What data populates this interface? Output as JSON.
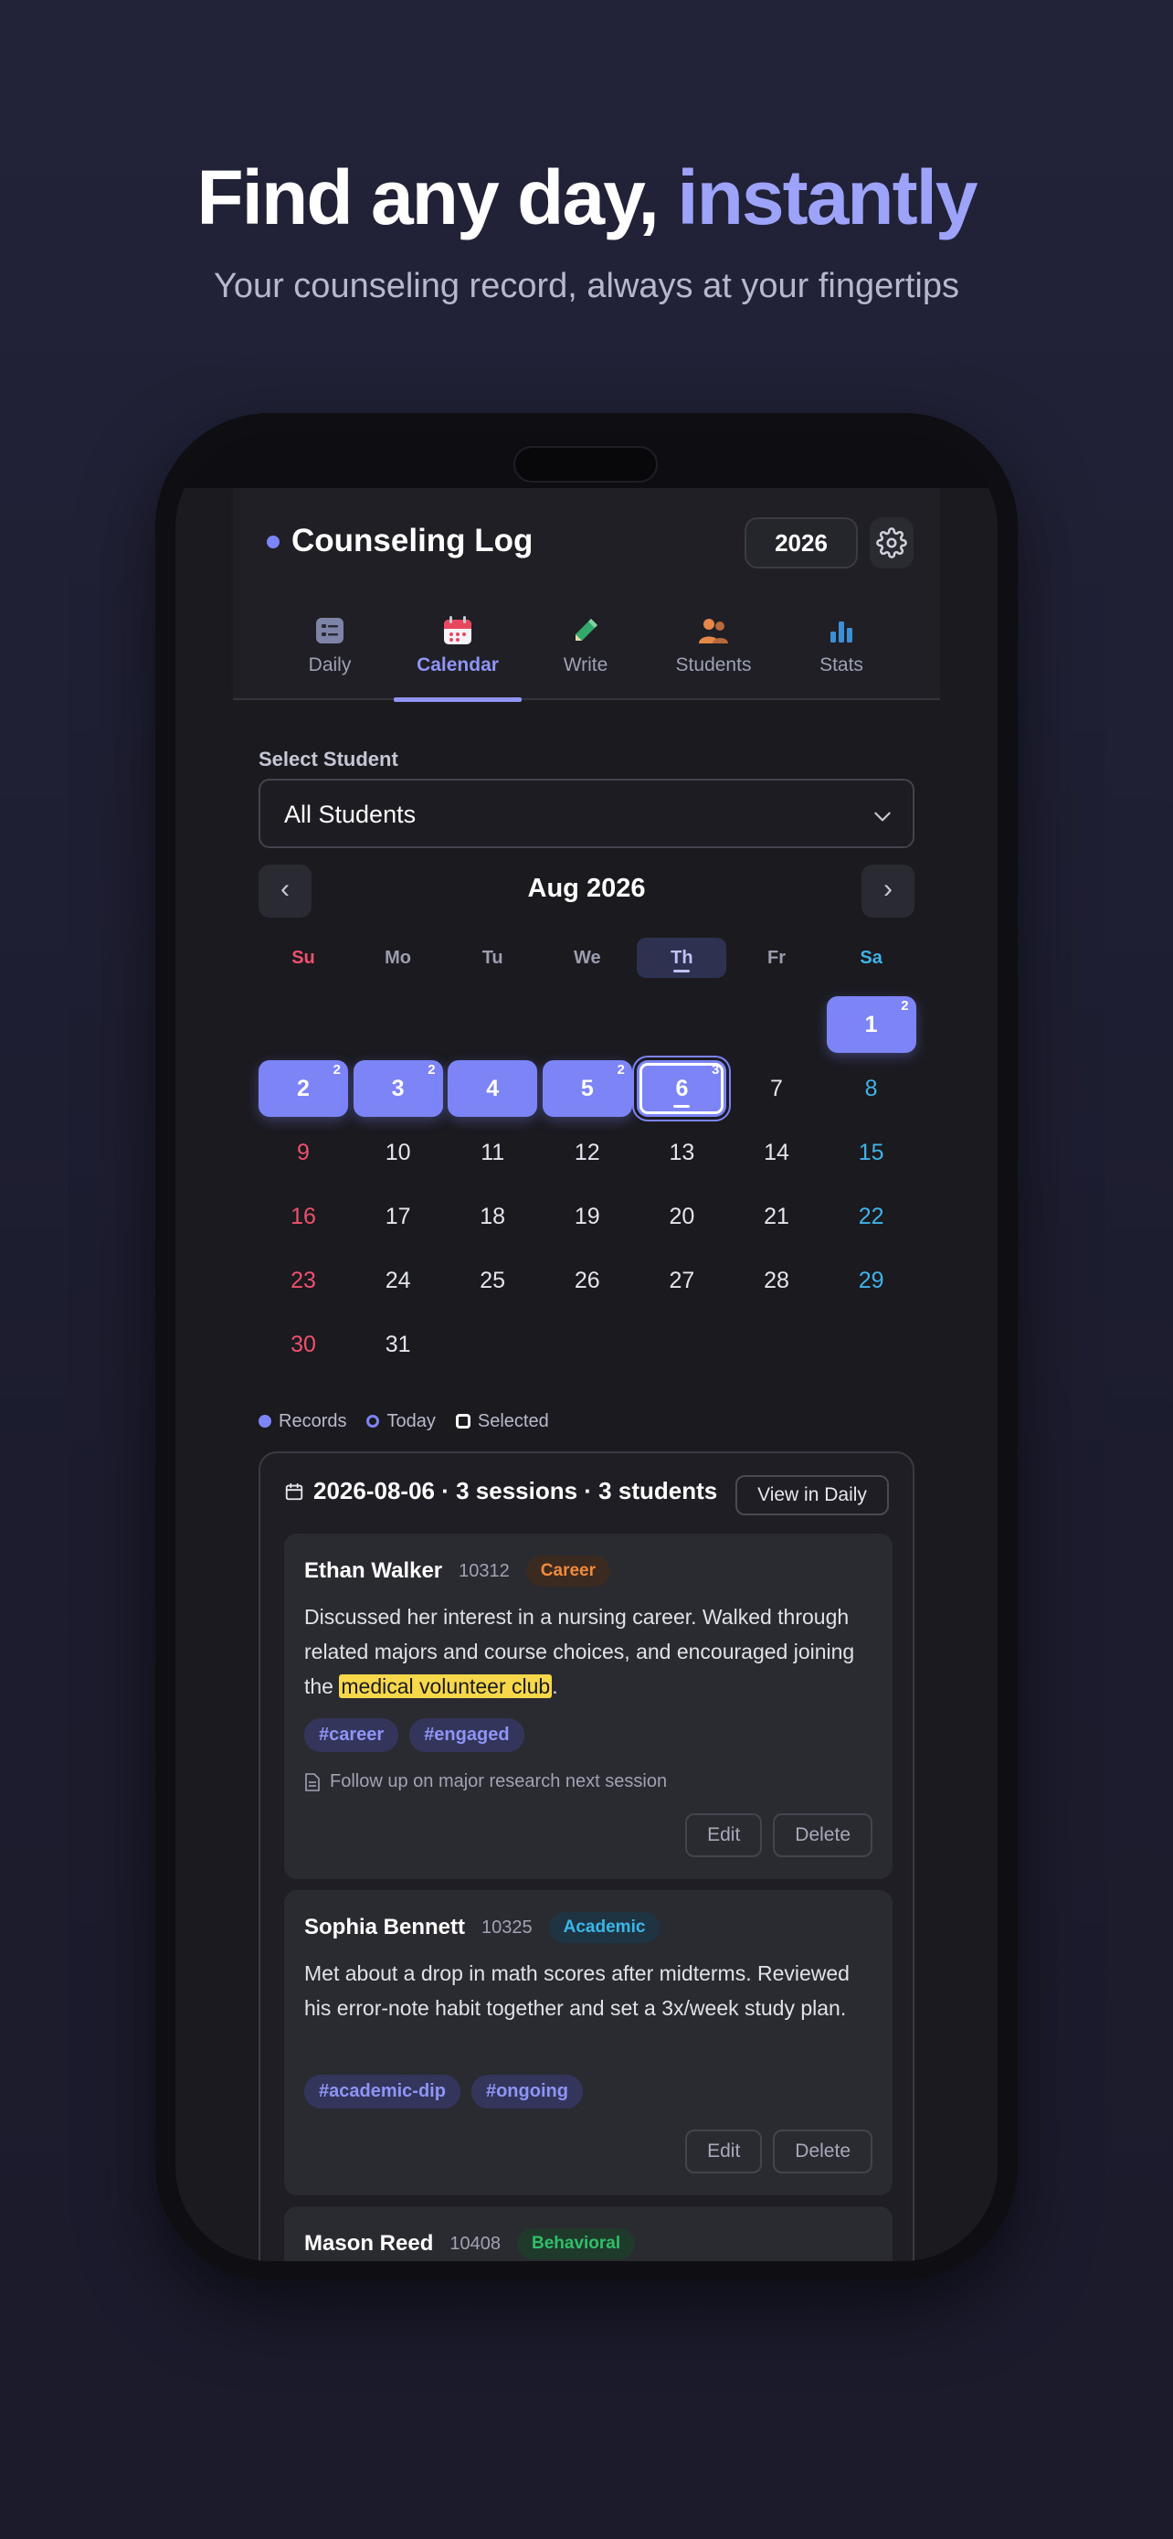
{
  "hero": {
    "title_main": "Find any day, ",
    "title_accent": "instantly",
    "subtitle": "Your counseling record, always at your fingertips"
  },
  "app": {
    "title": "Counseling Log",
    "year": "2026",
    "tabs": [
      {
        "label": "Daily",
        "icon": "daily-list-icon"
      },
      {
        "label": "Calendar",
        "icon": "calendar-icon",
        "active": true
      },
      {
        "label": "Write",
        "icon": "pencil-icon"
      },
      {
        "label": "Students",
        "icon": "students-icon"
      },
      {
        "label": "Stats",
        "icon": "bar-chart-icon"
      }
    ],
    "colors": {
      "accent": "#7C84F6",
      "sunday": "#F0506E",
      "saturday": "#3FB3E8",
      "highlight": "#F7D84B"
    }
  },
  "student_select": {
    "label": "Select Student",
    "value": "All Students"
  },
  "calendar": {
    "month_label": "Aug 2026",
    "prev": "‹",
    "next": "›",
    "weekdays": [
      "Su",
      "Mo",
      "Tu",
      "We",
      "Th",
      "Fr",
      "Sa"
    ],
    "today_weekday_index": 4,
    "first_weekday": 6,
    "days_in_month": 31,
    "records": {
      "1": 2,
      "2": 2,
      "3": 2,
      "4": 0,
      "5": 2,
      "6": 3
    },
    "today": 6,
    "selected": 6
  },
  "legend": {
    "records": "Records",
    "today": "Today",
    "selected": "Selected"
  },
  "panel": {
    "title": "2026-08-06 · 3 sessions · 3 students",
    "view_button": "View in Daily",
    "sessions": [
      {
        "name": "Ethan Walker",
        "id": "10312",
        "category": "Career",
        "text_before": "Discussed her interest in a nursing career. Walked through related majors and course choices, and encouraged joining the ",
        "text_highlight": "medical volunteer club",
        "text_after": ".",
        "tags": [
          "#career",
          "#engaged"
        ],
        "note": "Follow up on major research next session",
        "edit": "Edit",
        "delete": "Delete"
      },
      {
        "name": "Sophia Bennett",
        "id": "10325",
        "category": "Academic",
        "text": "Met about a drop in math scores after midterms. Reviewed his error-note habit together and set a 3x/week study plan.",
        "tags": [
          "#academic-dip",
          "#ongoing"
        ],
        "edit": "Edit",
        "delete": "Delete"
      },
      {
        "name": "Mason Reed",
        "id": "10408",
        "category": "Behavioral"
      }
    ]
  }
}
